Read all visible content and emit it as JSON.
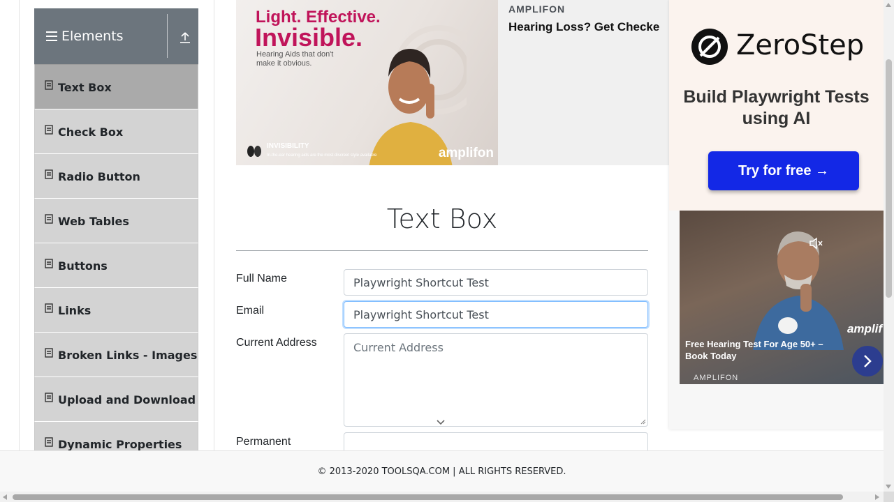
{
  "sidebar": {
    "group_title": "Elements",
    "items": [
      {
        "label": "Text Box",
        "active": true
      },
      {
        "label": "Check Box"
      },
      {
        "label": "Radio Button"
      },
      {
        "label": "Web Tables"
      },
      {
        "label": "Buttons"
      },
      {
        "label": "Links"
      },
      {
        "label": "Broken Links - Images"
      },
      {
        "label": "Upload and Download"
      },
      {
        "label": "Dynamic Properties"
      }
    ]
  },
  "ad_top": {
    "headline_line1": "Light. Effective.",
    "headline_line2": "Invisible.",
    "subtext": "Hearing Aids that don't make it obvious.",
    "invisibility_label": "INVISIBILITY",
    "invisibility_sub": "In-the-ear hearing aids are the most discreet style available",
    "brand_logo": "amplifon",
    "advertiser": "AMPLIFON",
    "ad_headline": "Hearing Loss? Get Checke"
  },
  "form": {
    "title": "Text Box",
    "full_name_label": "Full Name",
    "full_name_value": "Playwright Shortcut Test",
    "email_label": "Email",
    "email_value": "Playwright Shortcut Test",
    "current_address_label": "Current Address",
    "current_address_placeholder": "Current Address",
    "permanent_address_label": "Permanent"
  },
  "ad_right": {
    "brand": "ZeroStep",
    "tagline": "Build Playwright Tests using AI",
    "cta": "Try for free →",
    "video_brand_mark": "amplif",
    "video_caption": "Free Hearing Test For Age 50+ – Book Today",
    "video_advertiser": "AMPLIFON"
  },
  "footer": {
    "text": "© 2013-2020 TOOLSQA.COM | ALL RIGHTS RESERVED."
  },
  "colors": {
    "sidebar_header": "#6c757d",
    "sidebar_item": "#d3d3d3",
    "sidebar_item_active": "#aaaaaa",
    "ad_accent": "#c0145a",
    "cta_button": "#1328e6",
    "focus_border": "#80bdff"
  }
}
